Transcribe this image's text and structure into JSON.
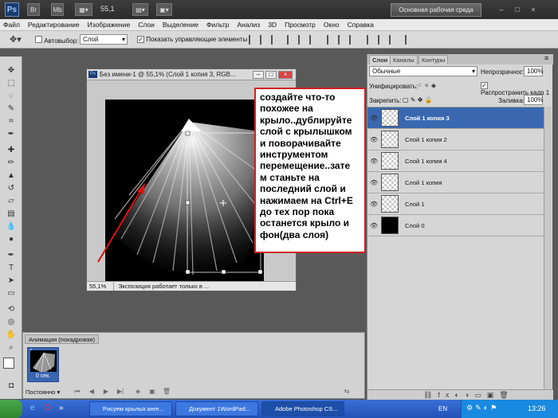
{
  "appbar": {
    "zoom": "55,1",
    "workspace": "Основная рабочая среда",
    "window_controls": [
      "–",
      "□",
      "×"
    ]
  },
  "menu": [
    "Файл",
    "Редактирование",
    "Изображение",
    "Слои",
    "Выделение",
    "Фильтр",
    "Анализ",
    "3D",
    "Просмотр",
    "Окно",
    "Справка"
  ],
  "options": {
    "autoselect_label": "Автовыбор:",
    "autoselect_value": "Слой",
    "show_controls_label": "Показать управляющие элементы"
  },
  "document": {
    "title": "Без имени-1 @ 55,1% (Слой 1 копия 3, RGB...",
    "zoom": "55,1%",
    "status": "Экспозиция работает только в ..."
  },
  "callout": {
    "text": "создайте что-то\nпохожее на\nкрыло..дублируйте\nслой с крылышком\nи поворачивайте\nинструментом\nперемещение..зате\nм станьте на\nпоследний слой и\nнажимаем на Ctrl+E\nдо тех пор пока\nостанется крыло и\nфон(два слоя)"
  },
  "layers_panel": {
    "tabs": [
      "Слои",
      "Каналы",
      "Контуры"
    ],
    "blend_mode": "Обычные",
    "opacity_label": "Непрозрачность:",
    "opacity_value": "100%",
    "unify_label": "Унифицировать:",
    "propagate_label": "Распространить кадр 1",
    "lock_label": "Закрепить:",
    "fill_label": "Заливка:",
    "fill_value": "100%",
    "layers": [
      {
        "name": "Слой 1 копия 3",
        "selected": true
      },
      {
        "name": "Слой 1 копия 2",
        "selected": false
      },
      {
        "name": "Слой 1 копия 4",
        "selected": false
      },
      {
        "name": "Слой 1 копия",
        "selected": false
      },
      {
        "name": "Слой 1",
        "selected": false
      },
      {
        "name": "Слой 0",
        "selected": false
      }
    ]
  },
  "animation": {
    "title": "Анимация (покадровая)",
    "frame_number": "1",
    "frame_time": "0 сек.",
    "loop": "Постоянно"
  },
  "taskbar": {
    "tasks": [
      "Рисуем крылья анге...",
      "Документ 1WordPad...",
      "Adobe Photoshop CS..."
    ],
    "language": "EN",
    "clock": "13:26"
  },
  "colors": {
    "selected_layer": "#3968b0",
    "callout_border": "#d02020",
    "arrow": "#e01010"
  }
}
